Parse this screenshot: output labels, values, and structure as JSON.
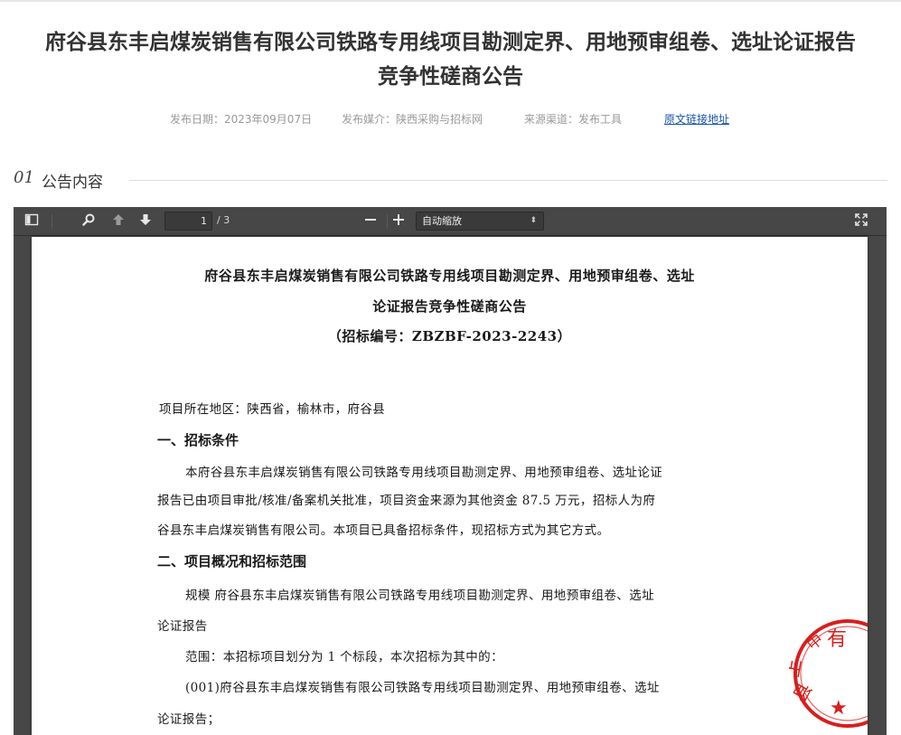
{
  "article": {
    "title_line1": "府谷县东丰启煤炭销售有限公司铁路专用线项目勘测定界、用地预审组卷、选址论证报告",
    "title_line2": "竞争性磋商公告",
    "publish_date": "发布日期：2023年09月07日",
    "publish_media": "发布媒介：陕西采购与招标网",
    "source_channel": "来源渠道：发布工具",
    "original_link": "原文链接地址"
  },
  "section": {
    "number": "01",
    "label": "公告内容"
  },
  "pdf_viewer": {
    "current_page": "1",
    "total_pages": "/ 3",
    "zoom_label": "自动缩放",
    "icons": [
      "sidebar-toggle-icon",
      "search-icon",
      "previous-page-icon",
      "next-page-icon",
      "zoom-out-icon",
      "zoom-in-icon",
      "fullscreen-icon"
    ]
  },
  "document": {
    "heading_line1": "府谷县东丰启煤炭销售有限公司铁路专用线项目勘测定界、用地预审组卷、选址",
    "heading_line2": "论证报告竞争性磋商公告",
    "heading_line3": "（招标编号：ZBZBF-2023-2243）",
    "region": "项目所在地区：陕西省，榆林市，府谷县",
    "section1_title": "一、招标条件",
    "section1_p1": "本府谷县东丰启煤炭销售有限公司铁路专用线项目勘测定界、用地预审组卷、选址论证",
    "section1_p2": "报告已由项目审批/核准/备案机关批准，项目资金来源为其他资金 87.5 万元，招标人为府",
    "section1_p3": "谷县东丰启煤炭销售有限公司。本项目已具备招标条件，现招标方式为其它方式。",
    "section2_title": "二、项目概况和招标范围",
    "section2_p1": "规模  府谷县东丰启煤炭销售有限公司铁路专用线项目勘测定界、用地预审组卷、选址",
    "section2_p2": "论证报告",
    "section2_p3": "范围：本招标项目划分为 1 个标段，本次招标为其中的：",
    "section2_p4": "(001)府谷县东丰启煤炭销售有限公司铁路专用线项目勘测定界、用地预审组卷、选址",
    "section2_p5": "论证报告；",
    "stamp_color": "#d81e1e"
  }
}
